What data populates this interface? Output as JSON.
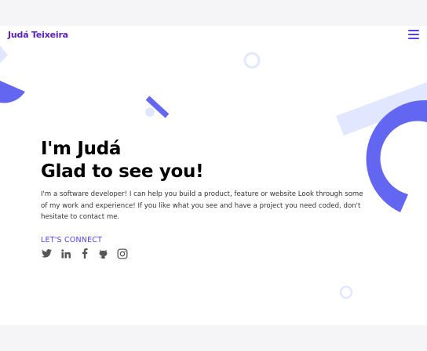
{
  "header": {
    "logo": "Judá Teixeira",
    "menu_icon": "hamburger-menu-icon"
  },
  "hero": {
    "title_line1": "I'm Judá",
    "title_line2": "Glad to see you!",
    "description": "I'm a software developer! I can help you build a product, feature or website Look through some of my work and experience! If you like what you see and have a project you need coded, don't hesitate to contact me.",
    "connect_label": "LET'S CONNECT"
  },
  "socials": [
    {
      "name": "twitter-icon"
    },
    {
      "name": "linkedin-icon"
    },
    {
      "name": "facebook-icon"
    },
    {
      "name": "github-icon"
    },
    {
      "name": "instagram-icon"
    }
  ],
  "colors": {
    "accent": "#4f46e5",
    "logo": "#5b21b6",
    "shape_primary": "#6366f1",
    "shape_light": "#e0e7ff"
  }
}
